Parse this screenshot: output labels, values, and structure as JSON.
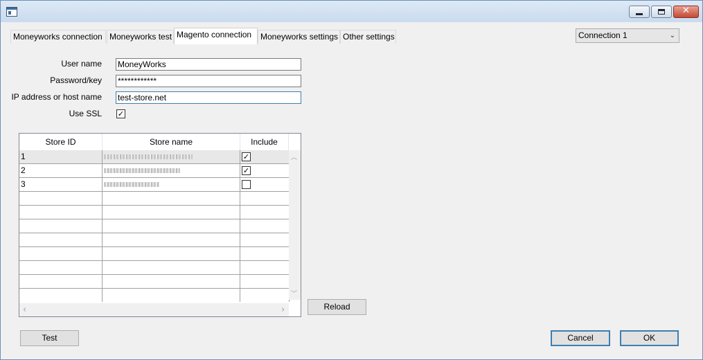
{
  "tabs": [
    "Moneyworks connection",
    "Moneyworks test",
    "Magento connection",
    "Moneyworks settings",
    "Other settings"
  ],
  "active_tab": "Magento connection",
  "connection_select": "Connection 1",
  "form": {
    "user_name_label": "User name",
    "user_name_value": "MoneyWorks",
    "password_label": "Password/key",
    "password_value": "************",
    "host_label": "IP address or host name",
    "host_value": "test-store.net",
    "ssl_label": "Use SSL",
    "ssl_checked": true
  },
  "store_table": {
    "headers": [
      "Store ID",
      "Store name",
      "Include"
    ],
    "rows": [
      {
        "id": "1",
        "include": true
      },
      {
        "id": "2",
        "include": true
      },
      {
        "id": "3",
        "include": false
      }
    ]
  },
  "buttons": {
    "reload": "Reload",
    "test": "Test",
    "cancel": "Cancel",
    "ok": "OK"
  },
  "icons": {
    "check": "✓",
    "chevron": "⌄",
    "close": "✕",
    "scroll_up": "︿",
    "scroll_down": "﹀",
    "scroll_left": "‹",
    "scroll_right": "›"
  }
}
